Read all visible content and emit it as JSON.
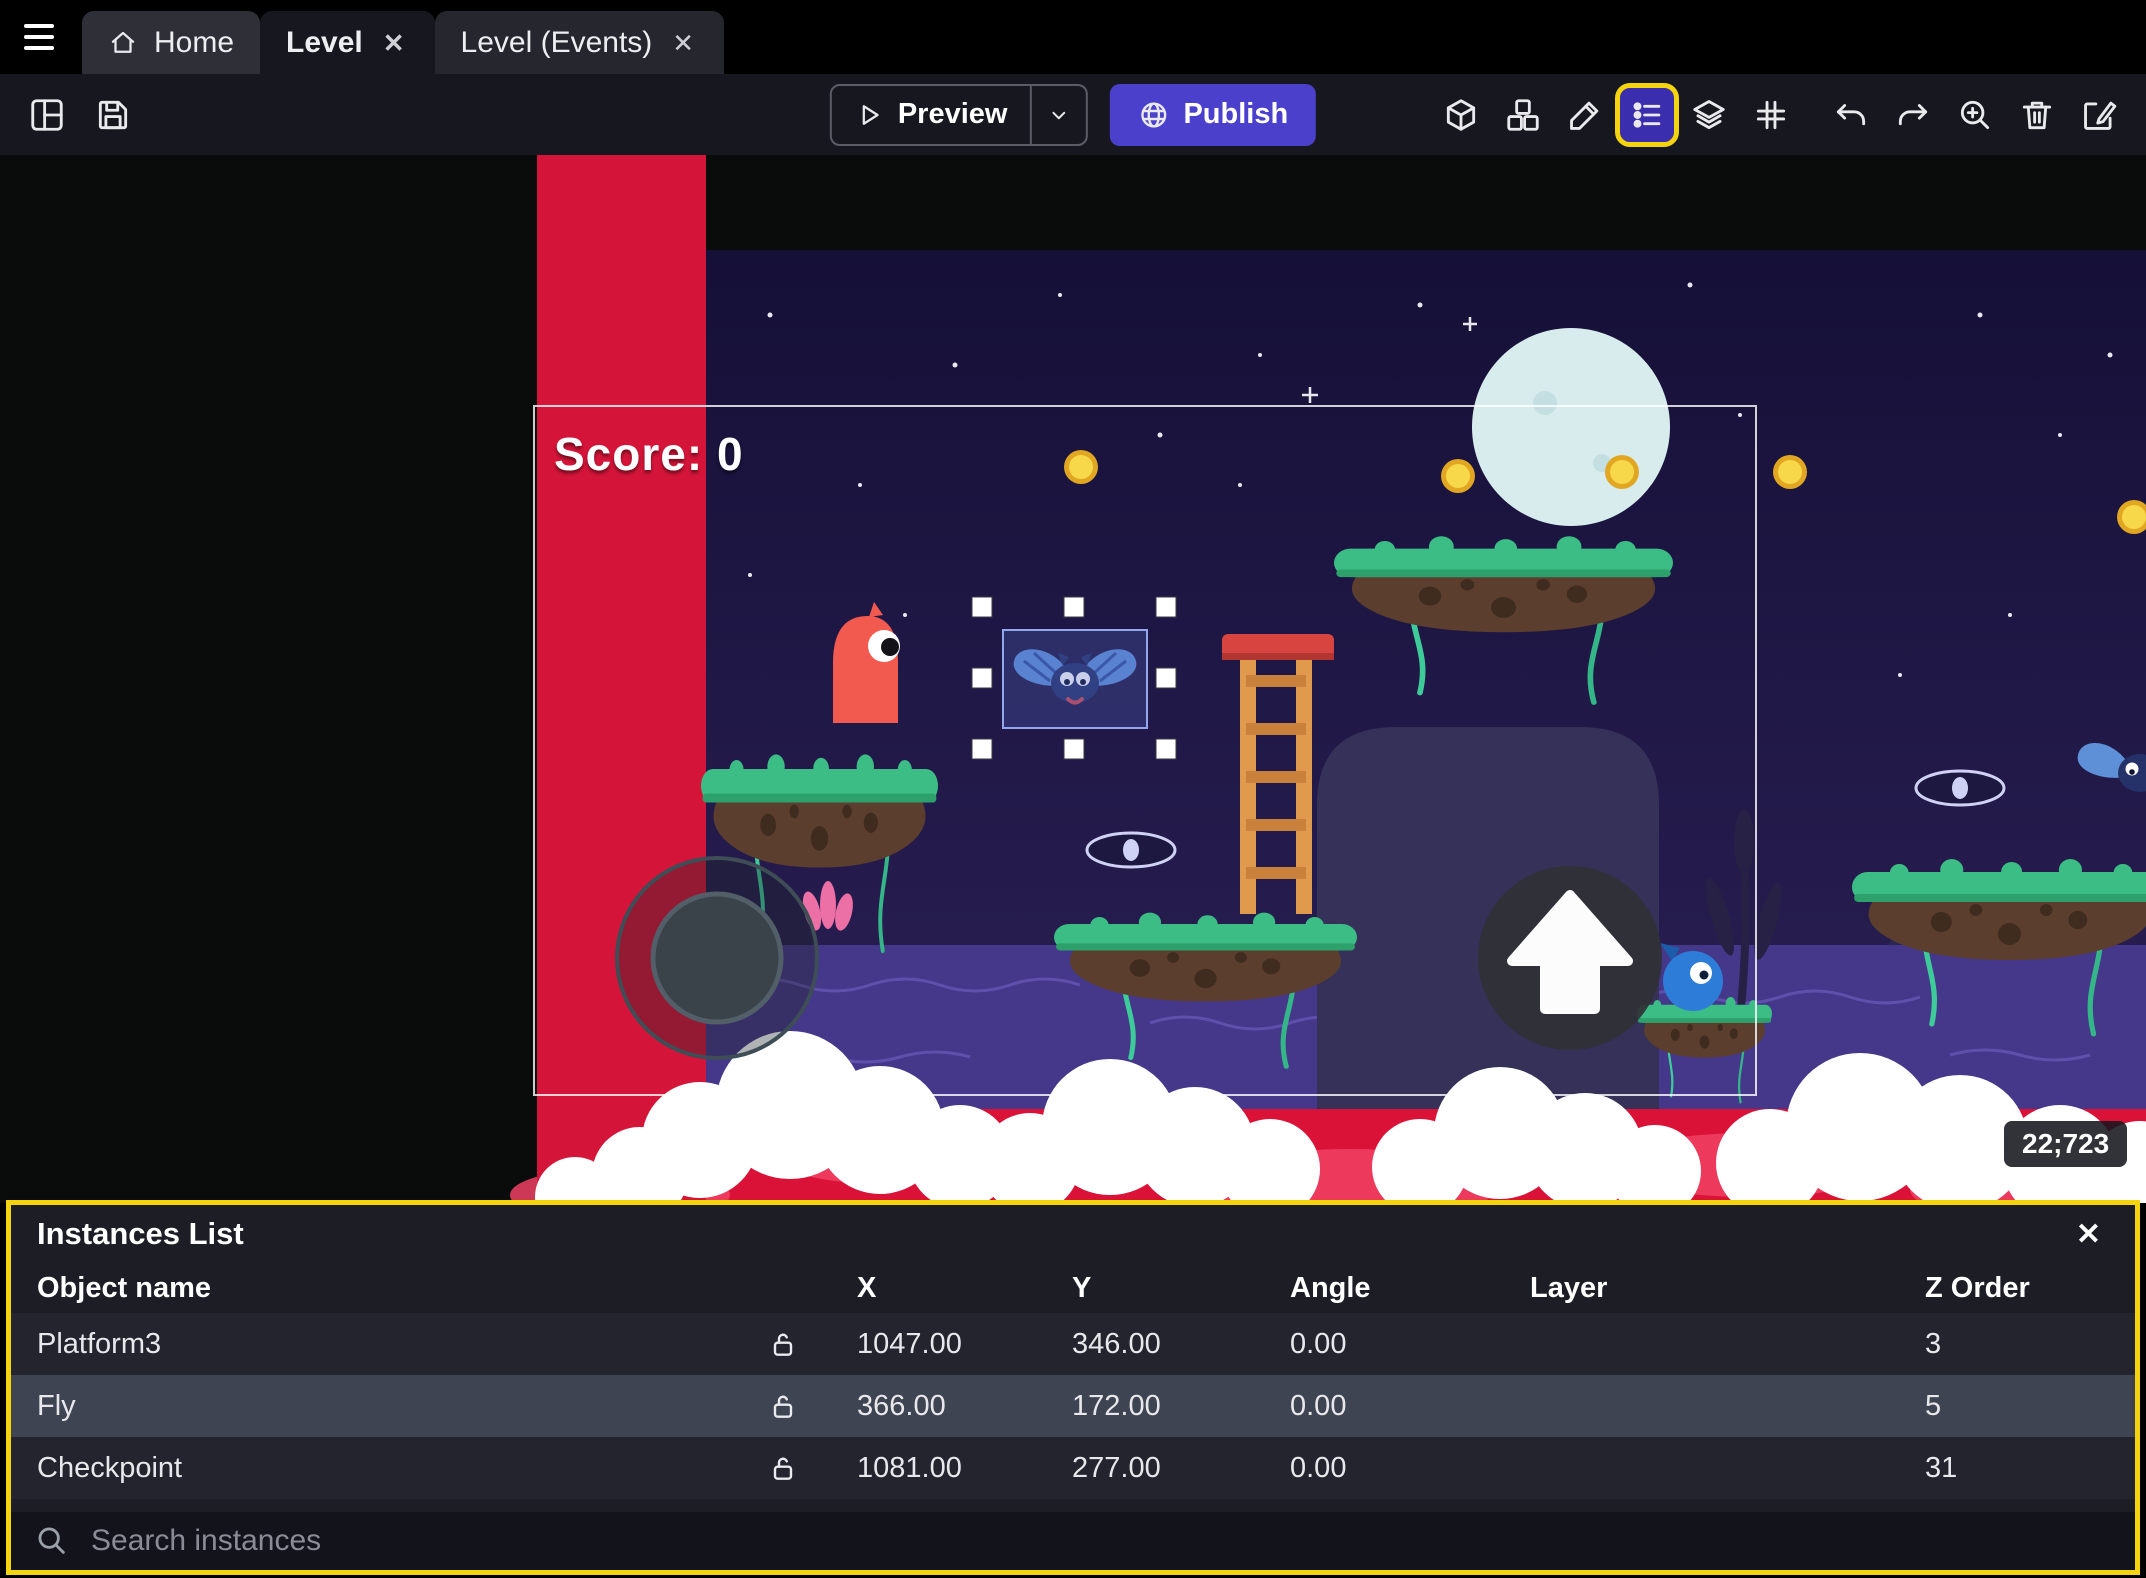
{
  "tabs": {
    "home": "Home",
    "level": "Level",
    "events": "Level (Events)"
  },
  "toolbar": {
    "preview": "Preview",
    "publish": "Publish"
  },
  "icons": {
    "close": "✕"
  },
  "canvas": {
    "score": "Score: 0",
    "coords_badge": "22;723"
  },
  "panel": {
    "title": "Instances List",
    "columns": [
      "Object name",
      "X",
      "Y",
      "Angle",
      "Layer",
      "Z Order"
    ],
    "rows": [
      {
        "name": "Platform3",
        "x": "1047.00",
        "y": "346.00",
        "angle": "0.00",
        "layer": "",
        "z": "3"
      },
      {
        "name": "Fly",
        "x": "366.00",
        "y": "172.00",
        "angle": "0.00",
        "layer": "",
        "z": "5"
      },
      {
        "name": "Checkpoint",
        "x": "1081.00",
        "y": "277.00",
        "angle": "0.00",
        "layer": "",
        "z": "31"
      }
    ],
    "search_placeholder": "Search instances"
  },
  "colors": {
    "accent_purple": "#4b40cc",
    "highlight_yellow": "#f4d40e",
    "scene_red": "#d41539"
  }
}
